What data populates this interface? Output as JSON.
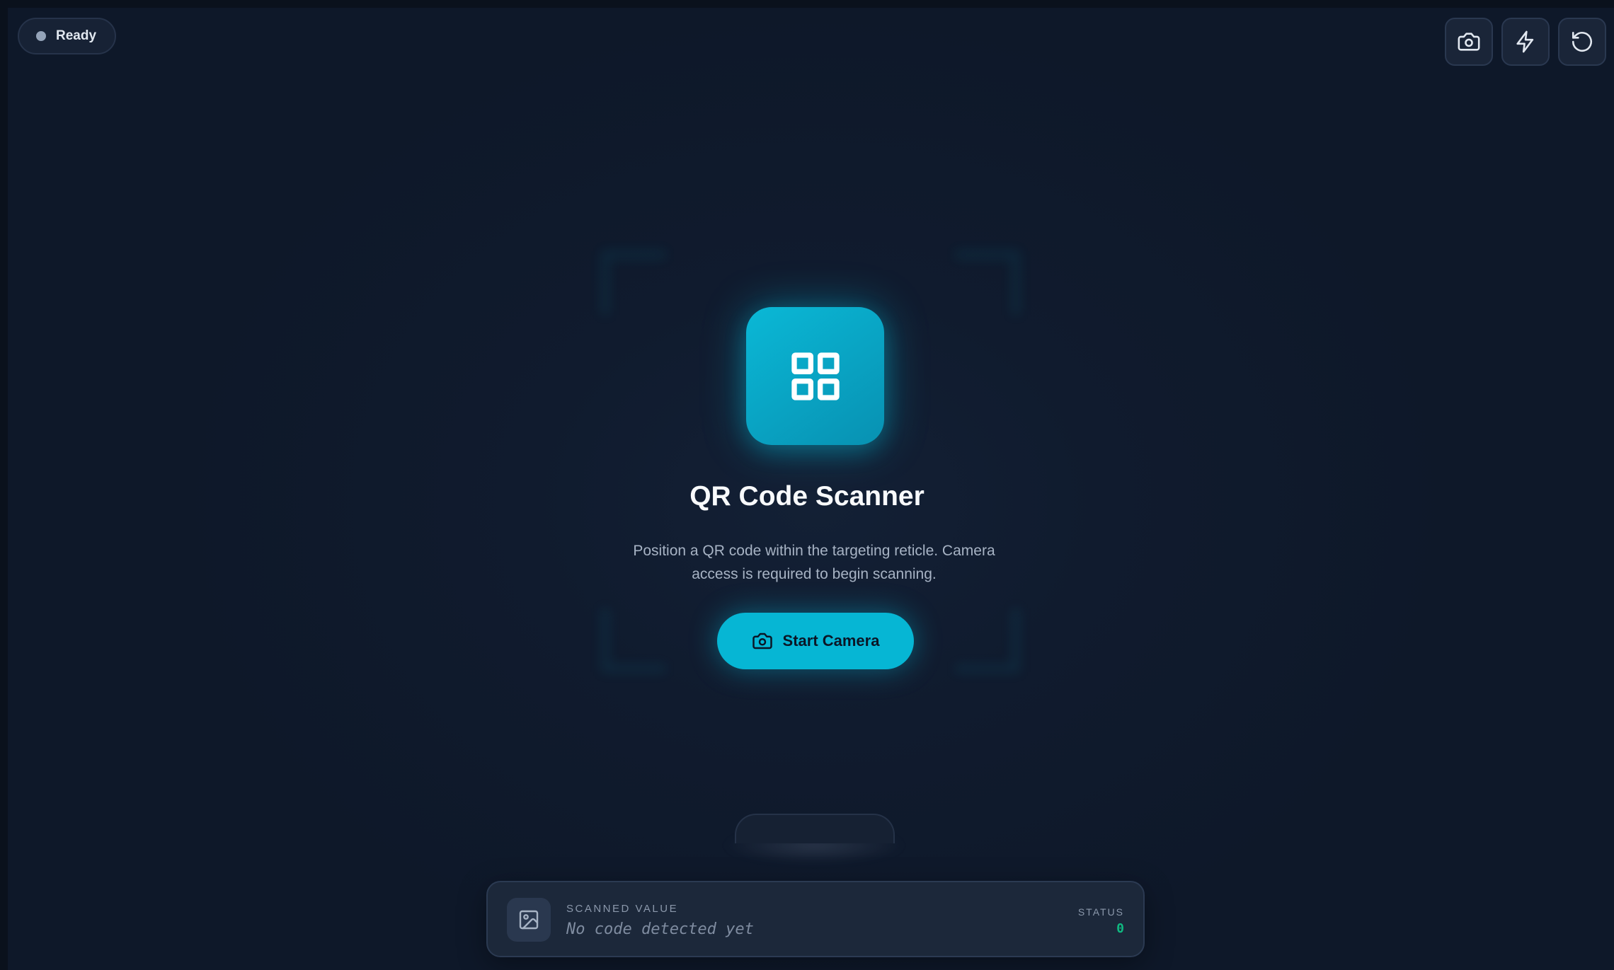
{
  "status": {
    "label": "Ready",
    "dot_color": "#94a3b8"
  },
  "toolbar": {
    "buttons": [
      {
        "icon": "camera-icon"
      },
      {
        "icon": "flash-icon"
      },
      {
        "icon": "reset-icon"
      }
    ]
  },
  "hero": {
    "icon": "qr-grid-icon",
    "title": "QR Code Scanner",
    "description": "Position a QR code within the targeting reticle. Camera access is required to begin scanning.",
    "start_button_label": "Start Camera",
    "start_button_icon": "camera-icon"
  },
  "result": {
    "icon": "image-icon",
    "label": "SCANNED VALUE",
    "value": "No code detected yet",
    "status_label": "STATUS",
    "status_count": "0"
  },
  "colors": {
    "accent": "#06b6d4",
    "background": "#101b2e",
    "success": "#10b981"
  }
}
